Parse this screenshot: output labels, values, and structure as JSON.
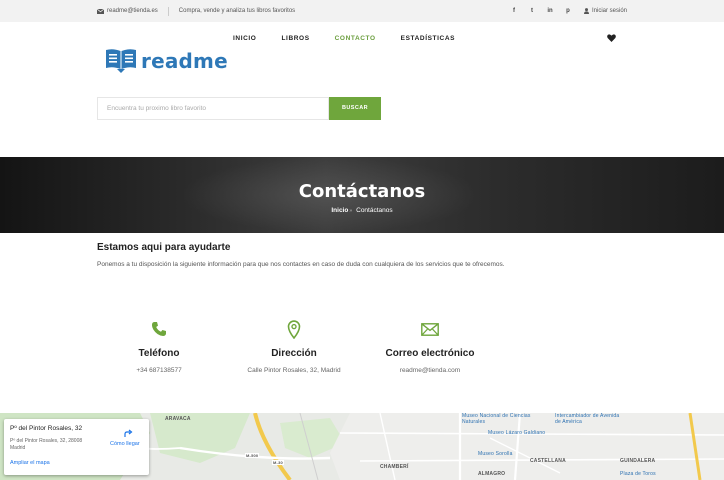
{
  "topbar": {
    "email": "readme@tienda.es",
    "tagline": "Compra, vende y analiza tus libros favoritos",
    "social": [
      "f",
      "t",
      "in",
      "p"
    ],
    "login": "Iniciar sesión"
  },
  "header": {
    "logo_text": "readme",
    "nav": [
      "INICIO",
      "LIBROS",
      "CONTACTO",
      "ESTADÍSTICAS"
    ],
    "active_nav": "CONTACTO",
    "search_placeholder": "Encuentra tu proximo libro favorito",
    "search_button": "BUSCAR"
  },
  "hero": {
    "title": "Contáctanos",
    "breadcrumb_home": "Inicio",
    "breadcrumb_current": "Contáctanos"
  },
  "help": {
    "title": "Estamos aqui para ayudarte",
    "text": "Ponemos a tu disposición la siguiente información para que nos contactes en caso de duda con cualquiera de los servicios que te ofrecemos."
  },
  "contact": [
    {
      "title": "Teléfono",
      "value": "+34 687138577",
      "icon": "phone-icon"
    },
    {
      "title": "Dirección",
      "value": "Calle Pintor Rosales, 32, Madrid",
      "icon": "map-pin-icon"
    },
    {
      "title": "Correo electrónico",
      "value": "readme@tienda.com",
      "icon": "envelope-icon"
    }
  ],
  "map": {
    "place_title": "Pº del Pintor Rosales, 32",
    "place_address": "Pº del Pintor Rosales, 32, 28008 Madrid",
    "directions": "Cómo llegar",
    "enlarge": "Ampliar el mapa",
    "labels": [
      "ARAVACA",
      "CHAMBERÍ",
      "ALMAGRO",
      "CASTELLANA",
      "GUINDALERA",
      "Museo Lázaro Galdiano",
      "Museo Sorolla",
      "Intercambiador de Avenida de América",
      "Museo Nacional de Ciencias Naturales",
      "Plaza de Toros",
      "M-500",
      "M-30"
    ]
  },
  "colors": {
    "accent": "#6fa63c",
    "brand": "#2e78b7"
  }
}
